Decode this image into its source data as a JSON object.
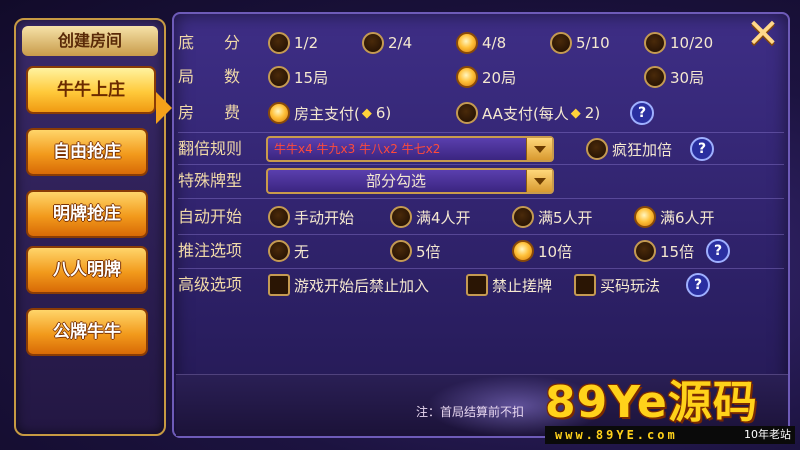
{
  "sidebar": {
    "title": "创建房间",
    "items": [
      {
        "label": "牛牛上庄",
        "active": true
      },
      {
        "label": "自由抢庄",
        "active": false
      },
      {
        "label": "明牌抢庄",
        "active": false
      },
      {
        "label": "八人明牌",
        "active": false
      },
      {
        "label": "公牌牛牛",
        "active": false
      }
    ]
  },
  "settings": {
    "base_score": {
      "label": "底分",
      "options": [
        {
          "text": "1/2",
          "selected": false
        },
        {
          "text": "2/4",
          "selected": false
        },
        {
          "text": "4/8",
          "selected": true
        },
        {
          "text": "5/10",
          "selected": false
        },
        {
          "text": "10/20",
          "selected": false
        }
      ]
    },
    "rounds": {
      "label": "局数",
      "options": [
        {
          "text": "15局",
          "selected": false
        },
        {
          "text": "20局",
          "selected": true
        },
        {
          "text": "30局",
          "selected": false
        }
      ]
    },
    "room_fee": {
      "label": "房费",
      "options": [
        {
          "text": "房主支付(",
          "gem": "◆",
          "amount": "6)",
          "selected": true
        },
        {
          "text": "AA支付(每人",
          "gem": "◆",
          "amount": "2)",
          "selected": false
        }
      ]
    },
    "multiplier_rules": {
      "label": "翻倍规则",
      "value": "牛牛x4    牛九x3    牛八x2    牛七x2",
      "crazy_double": "疯狂加倍"
    },
    "special_cards": {
      "label": "特殊牌型",
      "value": "部分勾选"
    },
    "auto_start": {
      "label": "自动开始",
      "options": [
        {
          "text": "手动开始",
          "selected": false
        },
        {
          "text": "满4人开",
          "selected": false
        },
        {
          "text": "满5人开",
          "selected": false
        },
        {
          "text": "满6人开",
          "selected": true
        }
      ]
    },
    "push_bet": {
      "label": "推注选项",
      "options": [
        {
          "text": "无",
          "selected": false
        },
        {
          "text": "5倍",
          "selected": false
        },
        {
          "text": "10倍",
          "selected": true
        },
        {
          "text": "15倍",
          "selected": false
        }
      ]
    },
    "advanced": {
      "label": "高级选项",
      "options": [
        {
          "text": "游戏开始后禁止加入"
        },
        {
          "text": "禁止搓牌"
        },
        {
          "text": "买码玩法"
        }
      ]
    }
  },
  "help_icon": "?",
  "close_icon": "✕",
  "footer": {
    "note": "注：首局结算前不扣"
  },
  "watermark": {
    "brand": "89Ye源码",
    "url": "www.89YE.com",
    "tag": "10年老站"
  },
  "colors": {
    "accent": "#f29a1c",
    "panel": "#2b1f63",
    "border": "#c79a43",
    "watermark": "#ffd21a"
  }
}
